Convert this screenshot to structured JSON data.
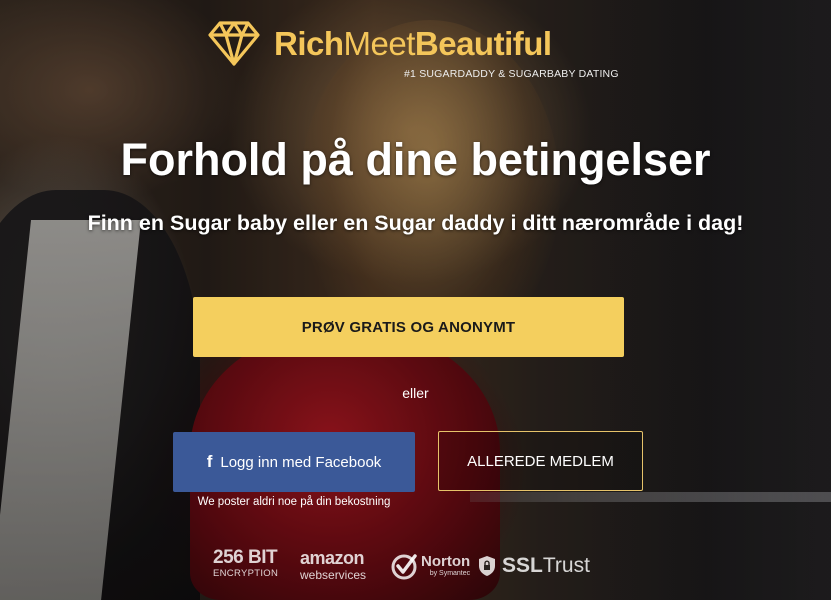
{
  "brand": {
    "name_part1": "Rich",
    "name_part2": "Meet",
    "name_part3": "Beautiful",
    "tagline": "#1 SUGARDADDY & SUGARBABY DATING",
    "accent_color": "#f4c65a"
  },
  "hero": {
    "headline": "Forhold på dine betingelser",
    "subheadline": "Finn en Sugar baby eller en Sugar daddy i ditt nærområde i dag!"
  },
  "actions": {
    "cta_label": "PRØV GRATIS OG ANONYMT",
    "cta_color": "#f4cf5e",
    "or_text": "eller",
    "facebook_icon": "f",
    "facebook_label": "Logg inn med Facebook",
    "facebook_color": "#3b5998",
    "facebook_note": "We poster aldri noe på din bekostning",
    "member_label": "ALLEREDE MEDLEM"
  },
  "trust_badges": {
    "encryption_big": "256 BIT",
    "encryption_small": "ENCRYPTION",
    "aws_big": "amazon",
    "aws_small": "webservices",
    "norton_big": "Norton",
    "norton_small": "by Symantec",
    "ssl_bold": "SSL",
    "ssl_regular": "Trust"
  },
  "icons": {
    "logo": "diamond-icon",
    "facebook": "facebook-icon",
    "norton": "checkmark-icon",
    "ssl": "shield-lock-icon"
  }
}
